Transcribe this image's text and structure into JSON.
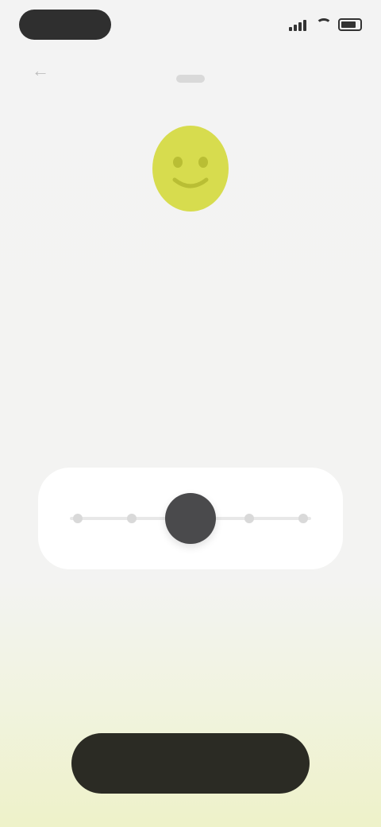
{
  "status_bar": {
    "time": ""
  },
  "header": {
    "back_icon": "arrow-left-icon"
  },
  "illustration": {
    "icon": "smiley-face-icon",
    "color": "#d7dc4e"
  },
  "content": {
    "title": "",
    "description": ""
  },
  "scale": {
    "left_label": "",
    "right_label": "",
    "value": 0.5
  },
  "actions": {
    "continue_label": ""
  },
  "colors": {
    "accent": "#d7dc4e",
    "button": "#2b2b24",
    "thumb": "#4a4a4c"
  }
}
